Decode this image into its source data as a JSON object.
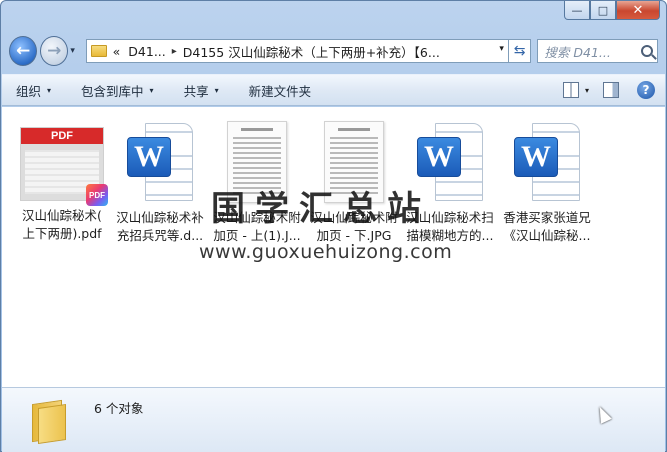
{
  "window": {
    "caption_min": "—",
    "caption_max": "□",
    "caption_close": "✕"
  },
  "nav": {
    "back_glyph": "←",
    "forward_glyph": "→",
    "history_glyph": "▾"
  },
  "address": {
    "overflow": "«",
    "crumb_1": "D41...",
    "separator": "▸",
    "crumb_2": "D4155 汉山仙踪秘术（上下两册+补充）【6...",
    "dropdown": "▾",
    "refresh_glyph": "⇆"
  },
  "search": {
    "placeholder": "搜索 D41..."
  },
  "toolbar": {
    "organize": "组织",
    "include_in_library": "包含到库中",
    "share": "共享",
    "new_folder": "新建文件夹",
    "arrow": "▾",
    "help": "?"
  },
  "files": [
    {
      "label_line1": "汉山仙踪秘术(",
      "label_line2": "上下两册).pdf",
      "type": "pdf",
      "thumb_text": "PDF",
      "badge_text": "PDF"
    },
    {
      "label_line1": "汉山仙踪秘术补",
      "label_line2": "充招兵咒等.d...",
      "type": "word",
      "icon_letter": "W"
    },
    {
      "label_line1": "汉山仙踪秘术附",
      "label_line2": "加页 - 上(1).J...",
      "type": "jpg"
    },
    {
      "label_line1": "汉山仙踪秘术附",
      "label_line2": "加页 - 下.JPG",
      "type": "jpg"
    },
    {
      "label_line1": "汉山仙踪秘术扫",
      "label_line2": "描模糊地方的...",
      "type": "word",
      "icon_letter": "W"
    },
    {
      "label_line1": "香港买家张道兄",
      "label_line2": "《汉山仙踪秘...",
      "type": "word",
      "icon_letter": "W"
    }
  ],
  "watermark": {
    "title": "国学汇总站",
    "url": "www.guoxuehuizong.com"
  },
  "details": {
    "count_text": "6 个对象"
  }
}
